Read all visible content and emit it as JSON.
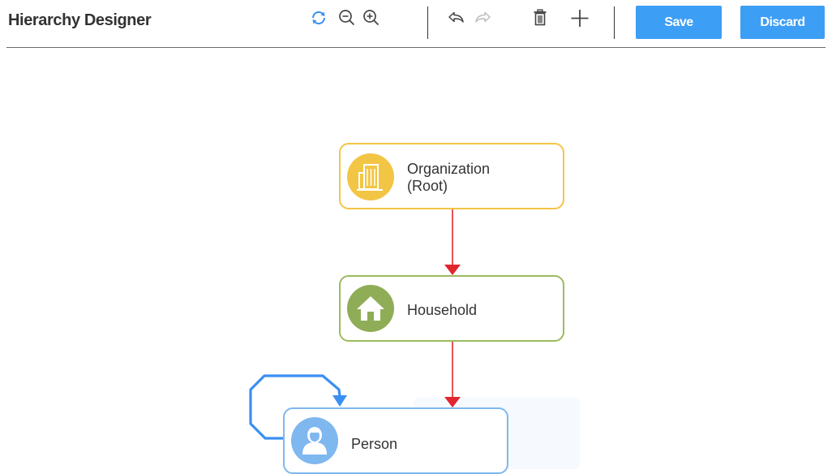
{
  "header": {
    "title": "Hierarchy Designer",
    "toolbar": {
      "refresh_icon": "refresh-icon",
      "zoom_out_icon": "zoom-out-icon",
      "zoom_in_icon": "zoom-in-icon",
      "undo_icon": "undo-icon",
      "redo_icon": "redo-icon",
      "delete_icon": "trash-icon",
      "add_icon": "plus-icon"
    },
    "save_label": "Save",
    "discard_label": "Discard"
  },
  "diagram": {
    "nodes": [
      {
        "id": "organization",
        "label_line1": "Organization",
        "label_line2": "(Root)",
        "icon": "building-icon",
        "border_color": "#f3c545",
        "icon_color": "#f3c545"
      },
      {
        "id": "household",
        "label": "Household",
        "icon": "house-icon",
        "border_color": "#9dbb5e",
        "icon_color": "#8fad57"
      },
      {
        "id": "person",
        "label": "Person",
        "icon": "person-icon",
        "border_color": "#7fb7ef",
        "icon_color": "#7fb7ef"
      }
    ],
    "edges": [
      {
        "from": "organization",
        "to": "household",
        "color": "#e0262e"
      },
      {
        "from": "household",
        "to": "person",
        "color": "#e0262e"
      },
      {
        "from": "person",
        "to": "person",
        "color": "#3a8ff2"
      }
    ]
  },
  "colors": {
    "accent": "#3d9ef5",
    "text": "#333333"
  }
}
